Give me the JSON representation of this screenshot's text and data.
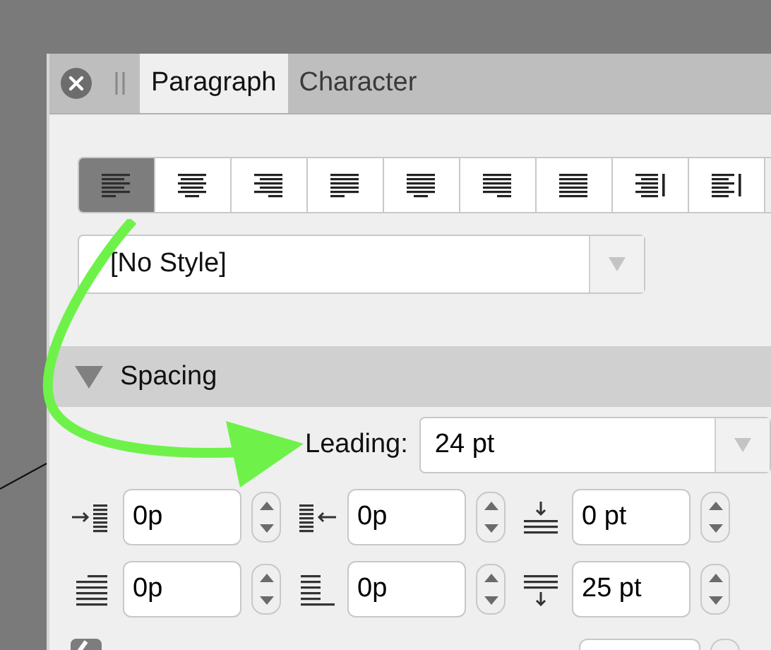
{
  "tabs": [
    {
      "label": "Paragraph",
      "selected": true
    },
    {
      "label": "Character",
      "selected": false
    }
  ],
  "alignment_buttons": [
    {
      "kind": "left",
      "selected": true
    },
    {
      "kind": "center",
      "selected": false
    },
    {
      "kind": "right",
      "selected": false
    },
    {
      "kind": "justify-left",
      "selected": false
    },
    {
      "kind": "justify-center",
      "selected": false
    },
    {
      "kind": "justify-right",
      "selected": false
    },
    {
      "kind": "justify-all",
      "selected": false
    },
    {
      "kind": "towards-spine",
      "selected": false
    },
    {
      "kind": "away-from-spine",
      "selected": false
    }
  ],
  "style_dropdown": {
    "value": "[No Style]"
  },
  "section": {
    "title": "Spacing",
    "expanded": true
  },
  "leading": {
    "label": "Leading:",
    "value": "24 pt"
  },
  "spacing_fields": [
    {
      "kind": "left-indent",
      "value": "0p"
    },
    {
      "kind": "right-indent",
      "value": "0p"
    },
    {
      "kind": "space-before",
      "value": "0 pt"
    },
    {
      "kind": "first-line-indent",
      "value": "0p"
    },
    {
      "kind": "last-line-indent",
      "value": "0p"
    },
    {
      "kind": "space-after",
      "value": "25 pt"
    }
  ],
  "option": {
    "checked": true
  }
}
